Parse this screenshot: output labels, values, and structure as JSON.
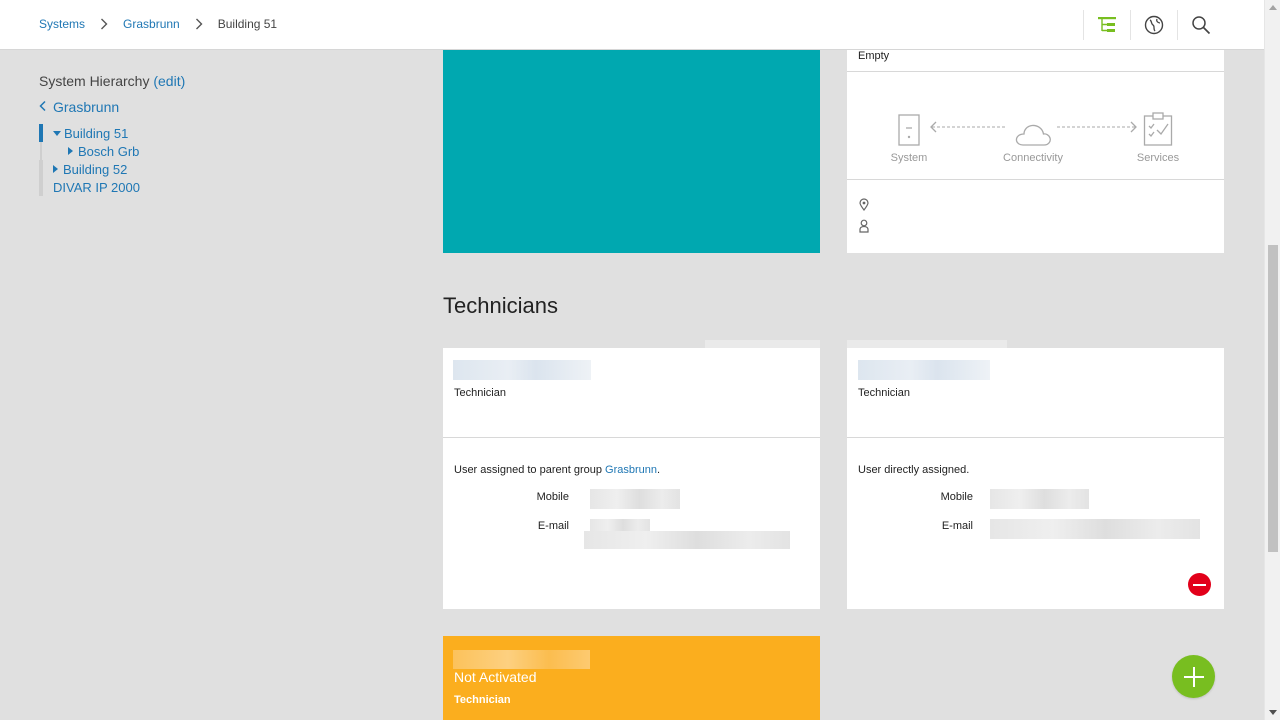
{
  "breadcrumb": {
    "items": [
      {
        "label": "Systems"
      },
      {
        "label": "Grasbrunn"
      }
    ],
    "current": "Building 51"
  },
  "header_icons": [
    "hierarchy-icon",
    "globe-icon",
    "search-icon"
  ],
  "sidebar": {
    "title": "System Hierarchy",
    "edit_label": "(edit)",
    "back_label": "Grasbrunn",
    "tree": [
      {
        "label": "Building 51",
        "level": 0,
        "expanded": true,
        "selected": true
      },
      {
        "label": "Bosch Grb",
        "level": 1,
        "expanded": false
      },
      {
        "label": "Building 52",
        "level": 0,
        "expanded": false
      },
      {
        "label": "DIVAR IP 2000",
        "level": 0,
        "leaf": true
      }
    ]
  },
  "system_card": {
    "status": "Empty",
    "flow": [
      "System",
      "Connectivity",
      "Services"
    ]
  },
  "technicians": {
    "title": "Technicians",
    "cards": [
      {
        "role": "Technician",
        "assign_text": "User assigned to parent group ",
        "assign_link": "Grasbrunn",
        "assign_suffix": ".",
        "mobile_label": "Mobile",
        "email_label": "E-mail"
      },
      {
        "role": "Technician",
        "assign_text": "User directly assigned.",
        "mobile_label": "Mobile",
        "email_label": "E-mail"
      }
    ],
    "pending": {
      "status": "Not Activated",
      "role": "Technician"
    }
  },
  "colors": {
    "accent_blue": "#1f77b4",
    "teal": "#00a8b0",
    "orange": "#fbae1e",
    "green": "#78be20",
    "red": "#e2001a"
  }
}
